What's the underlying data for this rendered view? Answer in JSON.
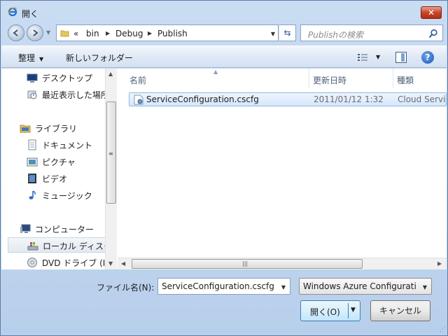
{
  "window": {
    "title": "開く",
    "close_label": "✕"
  },
  "address": {
    "overflow": "«",
    "crumbs": [
      "bin",
      "Debug",
      "Publish"
    ],
    "search_placeholder": "Publishの検索"
  },
  "toolbar": {
    "organize_label": "整理",
    "new_folder_label": "新しいフォルダー",
    "help_label": "?"
  },
  "nav": {
    "items": [
      {
        "label": "デスクトップ",
        "icon": "desktop-icon"
      },
      {
        "label": "最近表示した場所",
        "icon": "recent-places-icon"
      },
      {
        "label": "ライブラリ",
        "icon": "library-icon"
      },
      {
        "label": "ドキュメント",
        "icon": "documents-icon"
      },
      {
        "label": "ピクチャ",
        "icon": "pictures-icon"
      },
      {
        "label": "ビデオ",
        "icon": "videos-icon"
      },
      {
        "label": "ミュージック",
        "icon": "music-icon"
      },
      {
        "label": "コンピューター",
        "icon": "computer-icon"
      },
      {
        "label": "ローカル ディスク",
        "icon": "local-disk-icon"
      },
      {
        "label": "DVD ドライブ (I",
        "icon": "dvd-drive-icon"
      }
    ]
  },
  "files": {
    "columns": [
      "名前",
      "更新日時",
      "種類"
    ],
    "rows": [
      {
        "name": "ServiceConfiguration.cscfg",
        "date": "2011/01/12 1:32",
        "type": "Cloud Servi"
      }
    ]
  },
  "footer": {
    "filename_label": "ファイル名(N):",
    "filename_value": "ServiceConfiguration.cscfg",
    "filetype_value": "Windows Azure Configuratio",
    "open_label": "開く(O)",
    "cancel_label": "キャンセル"
  },
  "colors": {
    "accent": "#3c7fb1",
    "selection": "#d6e7fb",
    "chrome": "#c9dcf2"
  }
}
